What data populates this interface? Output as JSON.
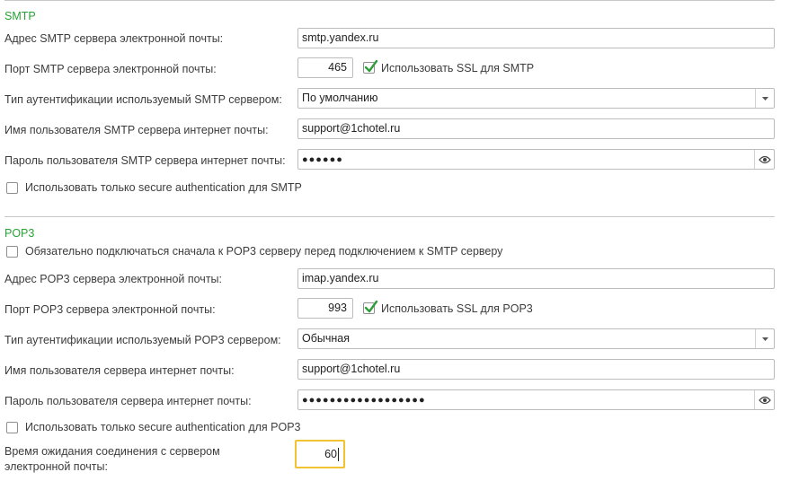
{
  "smtp": {
    "title": "SMTP",
    "server_label": "Адрес SMTP сервера электронной почты:",
    "server_value": "smtp.yandex.ru",
    "port_label": "Порт SMTP сервера электронной почты:",
    "port_value": "465",
    "ssl_label": "Использовать SSL для SMTP",
    "ssl_checked": true,
    "auth_label": "Тип аутентификации используемый SMTP сервером:",
    "auth_value": "По умолчанию",
    "user_label": "Имя пользователя SMTP сервера интернет почты:",
    "user_value": "support@1chotel.ru",
    "password_label": "Пароль пользователя SMTP сервера интернет почты:",
    "password_mask": "●●●●●●",
    "secure_auth_label": "Использовать только secure authentication для SMTP",
    "secure_auth_checked": false
  },
  "pop3": {
    "title": "POP3",
    "connect_first_label": "Обязательно подключаться сначала к POP3 серверу перед подключением к SMTP серверу",
    "connect_first_checked": false,
    "server_label": "Адрес POP3 сервера электронной почты:",
    "server_value": "imap.yandex.ru",
    "port_label": "Порт POP3 сервера электронной почты:",
    "port_value": "993",
    "ssl_label": "Использовать SSL для POP3",
    "ssl_checked": true,
    "auth_label": "Тип аутентификации используемый POP3 сервером:",
    "auth_value": "Обычная",
    "user_label": "Имя пользователя сервера интернет почты:",
    "user_value": "support@1chotel.ru",
    "password_label": "Пароль пользователя сервера интернет почты:",
    "password_mask": "●●●●●●●●●●●●●●●●●●",
    "secure_auth_label": "Использовать только secure authentication для POP3",
    "secure_auth_checked": false
  },
  "timeout": {
    "label_line1": "Время ожидания соединения с сервером",
    "label_line2": "электронной почты:",
    "value": "60"
  },
  "colors": {
    "section_title": "#27a234",
    "focus_border": "#f1c232",
    "checkmark": "#2e9e3a"
  },
  "icons": {
    "dropdown": "triangle-down-icon",
    "reveal_password": "eye-icon",
    "checkbox_checked": "checkmark-icon"
  }
}
